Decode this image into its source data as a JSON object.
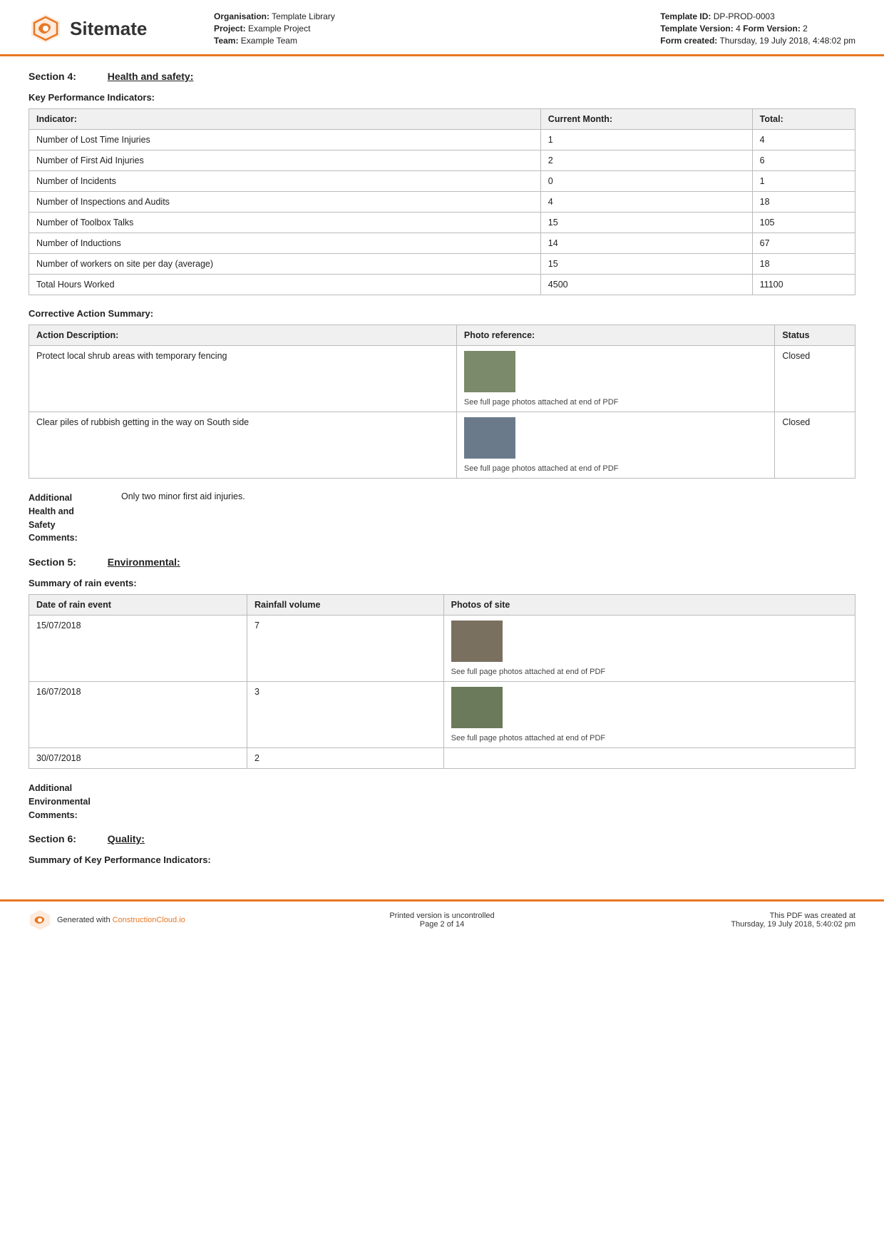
{
  "header": {
    "logo_text": "Sitemate",
    "org_label": "Organisation:",
    "org_value": "Template Library",
    "project_label": "Project:",
    "project_value": "Example Project",
    "team_label": "Team:",
    "team_value": "Example Team",
    "template_id_label": "Template ID:",
    "template_id_value": "DP-PROD-0003",
    "template_version_label": "Template Version:",
    "template_version_value": "4",
    "form_version_label": "Form Version:",
    "form_version_value": "2",
    "form_created_label": "Form created:",
    "form_created_value": "Thursday, 19 July 2018, 4:48:02 pm"
  },
  "section4": {
    "number": "Section 4:",
    "title": "Health and safety:",
    "kpi_heading": "Key Performance Indicators:",
    "kpi_table": {
      "headers": [
        "Indicator:",
        "Current Month:",
        "Total:"
      ],
      "rows": [
        [
          "Number of Lost Time Injuries",
          "1",
          "4"
        ],
        [
          "Number of First Aid Injuries",
          "2",
          "6"
        ],
        [
          "Number of Incidents",
          "0",
          "1"
        ],
        [
          "Number of Inspections and Audits",
          "4",
          "18"
        ],
        [
          "Number of Toolbox Talks",
          "15",
          "105"
        ],
        [
          "Number of Inductions",
          "14",
          "67"
        ],
        [
          "Number of workers on site per day (average)",
          "15",
          "18"
        ],
        [
          "Total Hours Worked",
          "4500",
          "11100"
        ]
      ]
    },
    "corrective_heading": "Corrective Action Summary:",
    "corrective_table": {
      "headers": [
        "Action Description:",
        "Photo reference:",
        "Status"
      ],
      "rows": [
        {
          "description": "Protect local shrub areas with temporary fencing",
          "photo_caption": "See full page photos attached at end of PDF",
          "photo_class": "photo-shrub",
          "status": "Closed"
        },
        {
          "description": "Clear piles of rubbish getting in the way on South side",
          "photo_caption": "See full page photos attached at end of PDF",
          "photo_class": "photo-rubbish",
          "status": "Closed"
        }
      ]
    },
    "additional_label": "Additional\nHealth and\nSafety\nComments:",
    "additional_value": "Only two minor first aid injuries."
  },
  "section5": {
    "number": "Section 5:",
    "title": "Environmental:",
    "rain_heading": "Summary of rain events:",
    "rain_table": {
      "headers": [
        "Date of rain event",
        "Rainfall volume",
        "Photos of site"
      ],
      "rows": [
        {
          "date": "15/07/2018",
          "volume": "7",
          "photo_caption": "See full page photos attached at end of PDF",
          "photo_class": "photo-rain1",
          "has_photo": true
        },
        {
          "date": "16/07/2018",
          "volume": "3",
          "photo_caption": "See full page photos attached at end of PDF",
          "photo_class": "photo-rain2",
          "has_photo": true
        },
        {
          "date": "30/07/2018",
          "volume": "2",
          "photo_caption": "",
          "photo_class": "",
          "has_photo": false
        }
      ]
    },
    "additional_label": "Additional\nEnvironmental\nComments:",
    "additional_value": ""
  },
  "section6": {
    "number": "Section 6:",
    "title": "Quality:",
    "kpi_heading": "Summary of Key Performance Indicators:"
  },
  "footer": {
    "generated_text": "Generated with ",
    "link_text": "ConstructionCloud.io",
    "center_line1": "Printed version is uncontrolled",
    "center_line2": "Page 2 of 14",
    "right_line1": "This PDF was created at",
    "right_line2": "Thursday, 19 July 2018, 5:40:02 pm"
  }
}
